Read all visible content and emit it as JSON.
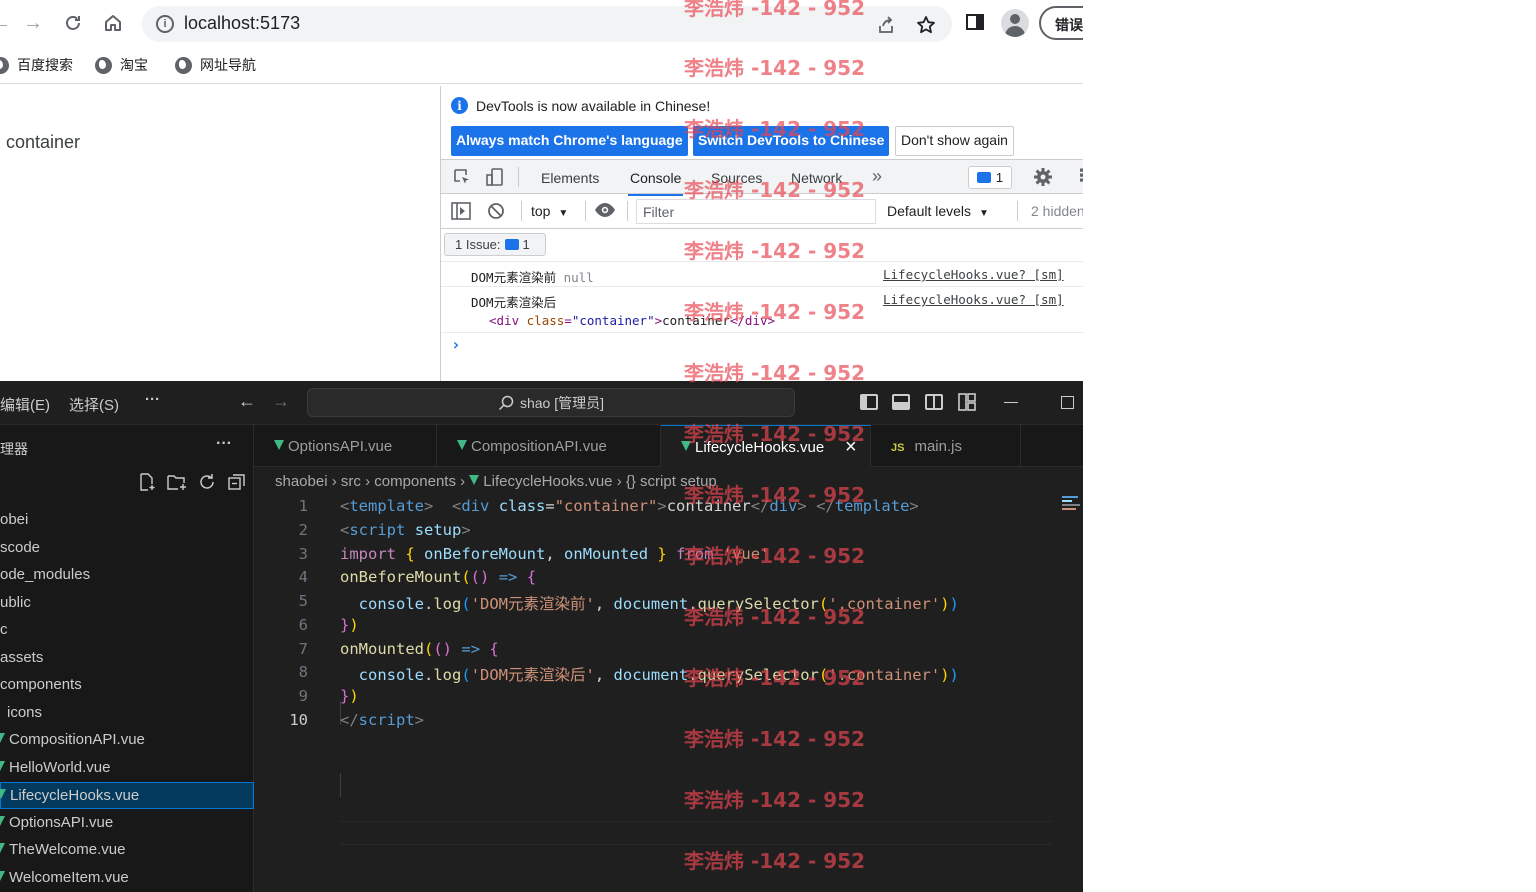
{
  "browser": {
    "url": "localhost:5173",
    "error_button": "错误",
    "bookmarks": [
      "百度搜索",
      "淘宝",
      "网址导航"
    ],
    "page_text": "container"
  },
  "devtools": {
    "notice": "DevTools is now available in Chinese!",
    "btn_match": "Always match Chrome's language",
    "btn_switch": "Switch DevTools to Chinese",
    "btn_dont_show": "Don't show again",
    "tabs": [
      "Elements",
      "Console",
      "Sources",
      "Network"
    ],
    "active_tab": "Console",
    "message_count": "1",
    "context": "top",
    "filter_placeholder": "Filter",
    "levels": "Default levels",
    "hidden": "2 hidden",
    "issue_label": "1 Issue:",
    "issue_count": "1",
    "logs": [
      {
        "text": "DOM元素渲染前",
        "value": "null",
        "source": "LifecycleHooks.vue? [sm]"
      },
      {
        "text": "DOM元素渲染后",
        "source": "LifecycleHooks.vue? [sm]",
        "element": {
          "open": "<div",
          "attr": "class",
          "eq": "=",
          "val": "\"container\"",
          "close": ">",
          "content": "container",
          "end": "</div>"
        }
      }
    ],
    "prompt": "›"
  },
  "vscode": {
    "menu": [
      "编辑(E)",
      "选择(S)",
      "···"
    ],
    "search": "shao [管理员]",
    "sidebar_title": "理器",
    "sidebar_more": "···",
    "tree": [
      {
        "label": "obei",
        "indent": 0,
        "vue": false
      },
      {
        "label": "scode",
        "indent": 0,
        "vue": false
      },
      {
        "label": "ode_modules",
        "indent": 0,
        "vue": false
      },
      {
        "label": "ublic",
        "indent": 0,
        "vue": false
      },
      {
        "label": "c",
        "indent": 0,
        "vue": false
      },
      {
        "label": "assets",
        "indent": 0,
        "vue": false
      },
      {
        "label": "components",
        "indent": 0,
        "vue": false
      },
      {
        "label": "icons",
        "indent": 1,
        "vue": false
      },
      {
        "label": "CompositionAPI.vue",
        "indent": 0,
        "vue": true
      },
      {
        "label": "HelloWorld.vue",
        "indent": 0,
        "vue": true
      },
      {
        "label": "LifecycleHooks.vue",
        "indent": 0,
        "vue": true,
        "selected": true
      },
      {
        "label": "OptionsAPI.vue",
        "indent": 0,
        "vue": true
      },
      {
        "label": "TheWelcome.vue",
        "indent": 0,
        "vue": true
      },
      {
        "label": "WelcomeItem.vue",
        "indent": 0,
        "vue": true
      }
    ],
    "tabs": [
      {
        "label": "OptionsAPI.vue",
        "type": "vue"
      },
      {
        "label": "CompositionAPI.vue",
        "type": "vue"
      },
      {
        "label": "LifecycleHooks.vue",
        "type": "vue",
        "active": true
      },
      {
        "label": "main.js",
        "type": "js"
      }
    ],
    "tab_close": "×",
    "js_badge": "JS",
    "breadcrumbs": [
      "shaobei",
      "src",
      "components",
      "LifecycleHooks.vue",
      "{} script setup"
    ],
    "line_numbers": [
      "1",
      "2",
      "3",
      "4",
      "5",
      "6",
      "7",
      "8",
      "9",
      "10"
    ]
  },
  "watermark": "李浩炜 -142 - 952",
  "colors": {
    "devtools_accent": "#1a73e8",
    "vscode_bg": "#1f1f1f",
    "selection": "#04395e",
    "watermark": "#e84650"
  }
}
